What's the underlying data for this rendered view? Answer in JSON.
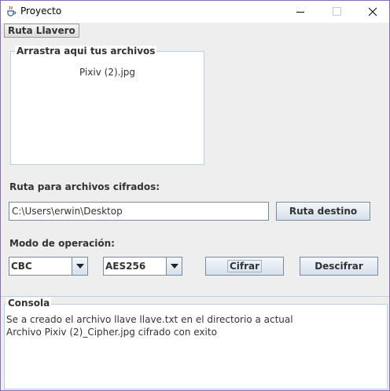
{
  "window": {
    "title": "Proyecto"
  },
  "menu": {
    "items": [
      "Ruta Llavero"
    ]
  },
  "drop_panel": {
    "title": "Arrastra aqui tus archivos",
    "files": [
      "Pixiv (2).jpg"
    ]
  },
  "destination": {
    "label": "Ruta para archivos cifrados:",
    "path_value": "C:\\Users\\erwin\\Desktop",
    "button_label": "Ruta destino"
  },
  "operation": {
    "label": "Modo de operación:",
    "mode_selected": "CBC",
    "algorithm_selected": "AES256",
    "encrypt_label": "Cifrar",
    "decrypt_label": "Descifrar"
  },
  "console": {
    "title": "Consola",
    "lines": [
      "Se a creado el archivo llave llave.txt en el directorio a actual",
      "Archivo Pixiv (2)_Cipher.jpg cifrado con exito"
    ]
  }
}
